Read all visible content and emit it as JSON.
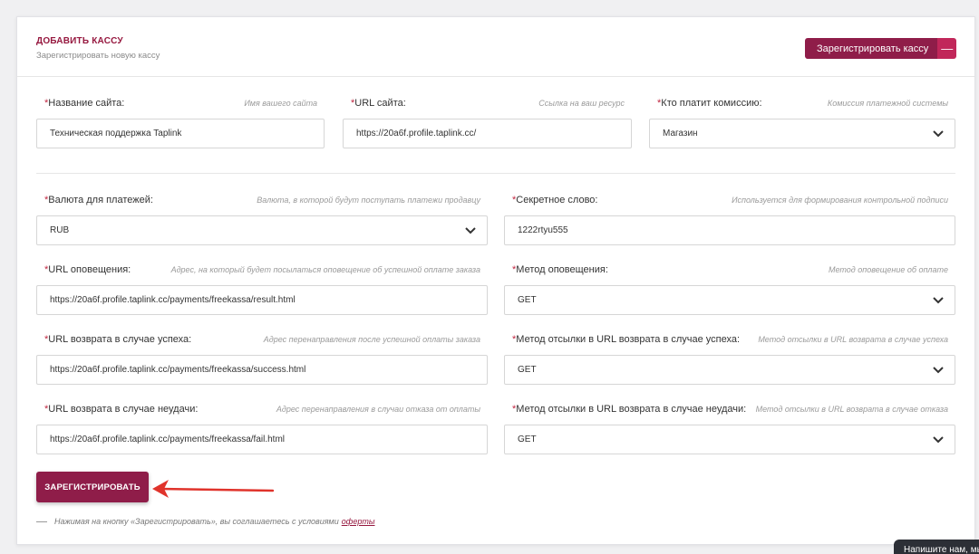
{
  "header": {
    "title": "ДОБАВИТЬ КАССУ",
    "subtitle": "Зарегистрировать новую кассу",
    "register_button_label": "Зарегистрировать кассу",
    "register_button_toggle": "—"
  },
  "fields": {
    "site_name": {
      "required_mark": "*",
      "label": "Название сайта:",
      "hint": "Имя вашего сайта",
      "value": "Техническая поддержка Taplink"
    },
    "site_url": {
      "required_mark": "*",
      "label": "URL сайта:",
      "hint": "Ссылка на ваш ресурс",
      "value": "https://20a6f.profile.taplink.cc/"
    },
    "commission_payer": {
      "required_mark": "*",
      "label": "Кто платит комиссию:",
      "hint": "Комиссия платежной системы",
      "value": "Магазин"
    },
    "currency": {
      "required_mark": "*",
      "label": "Валюта для платежей:",
      "hint": "Валюта, в которой будут поступать платежи продавцу",
      "value": "RUB"
    },
    "secret_word": {
      "required_mark": "*",
      "label": "Секретное слово:",
      "hint": "Используется для формирования контрольной подписи",
      "value": "1222rtyu555"
    },
    "notify_url": {
      "required_mark": "*",
      "label": "URL оповещения:",
      "hint": "Адрес, на который будет посылаться оповещение об успешной оплате заказа",
      "value": "https://20a6f.profile.taplink.cc/payments/freekassa/result.html"
    },
    "notify_method": {
      "required_mark": "*",
      "label": "Метод оповещения:",
      "hint": "Метод оповещение об оплате",
      "value": "GET"
    },
    "success_url": {
      "required_mark": "*",
      "label": "URL возврата в случае успеха:",
      "hint": "Адрес перенаправления после успешной оплаты заказа",
      "value": "https://20a6f.profile.taplink.cc/payments/freekassa/success.html"
    },
    "success_method": {
      "required_mark": "*",
      "label": "Метод отсылки в URL возврата в случае успеха:",
      "hint": "Метод отсылки в URL возврата в случае успеха",
      "value": "GET"
    },
    "fail_url": {
      "required_mark": "*",
      "label": "URL возврата в случае неудачи:",
      "hint": "Адрес перенаправления в случаи отказа от оплаты",
      "value": "https://20a6f.profile.taplink.cc/payments/freekassa/fail.html"
    },
    "fail_method": {
      "required_mark": "*",
      "label": "Метод отсылки в URL возврата в случае неудачи:",
      "hint": "Метод отсылки в URL возврата в случае отказа",
      "value": "GET"
    }
  },
  "submit": {
    "label": "ЗАРЕГИСТРИРОВАТЬ"
  },
  "agreement": {
    "text": "Нажимая на кнопку «Зарегистрировать», вы соглашаетесь с условиями",
    "link": "оферты"
  },
  "chat_widget": {
    "label": "Напишите нам, мы онлайн!"
  },
  "colors": {
    "accent": "#8f1d49",
    "accent_light": "#c1275a",
    "required": "#c0243f",
    "arrow": "#e0332b"
  },
  "icons": {
    "select": "chevron-down-icon",
    "annotation": "red-arrow-icon"
  }
}
